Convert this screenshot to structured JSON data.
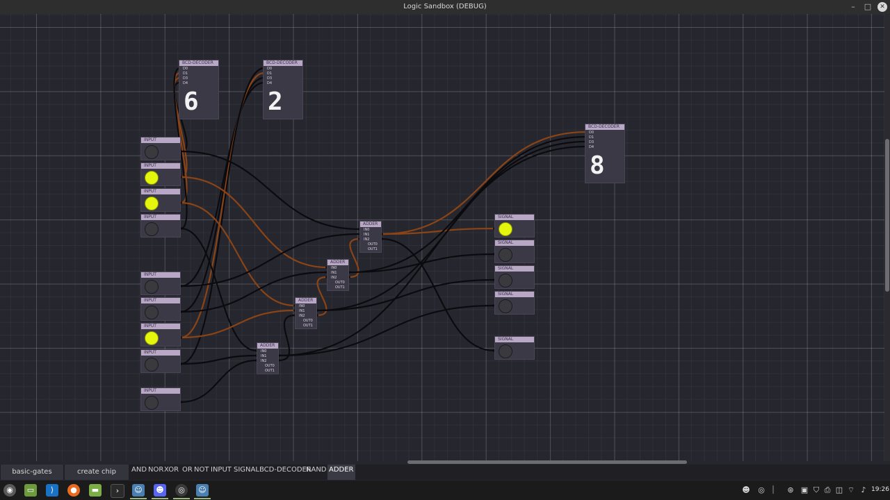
{
  "window": {
    "title": "Logic Sandbox (DEBUG)"
  },
  "colors": {
    "wire_off": "#0b0b0f",
    "wire_on": "#8a4416",
    "led_on": "#e4f50e"
  },
  "inputs": [
    {
      "id": "in1",
      "label": "INPUT",
      "on": false
    },
    {
      "id": "in2",
      "label": "INPUT",
      "on": true
    },
    {
      "id": "in3",
      "label": "INPUT",
      "on": true
    },
    {
      "id": "in4",
      "label": "INPUT",
      "on": false
    },
    {
      "id": "in5",
      "label": "INPUT",
      "on": false
    },
    {
      "id": "in6",
      "label": "INPUT",
      "on": false
    },
    {
      "id": "in7",
      "label": "INPUT",
      "on": true
    },
    {
      "id": "in8",
      "label": "INPUT",
      "on": false
    },
    {
      "id": "in9",
      "label": "INPUT",
      "on": false
    }
  ],
  "signals": [
    {
      "id": "s1",
      "label": "SIGNAL",
      "on": true
    },
    {
      "id": "s2",
      "label": "SIGNAL",
      "on": false
    },
    {
      "id": "s3",
      "label": "SIGNAL",
      "on": false
    },
    {
      "id": "s4",
      "label": "SIGNAL",
      "on": false
    },
    {
      "id": "s5",
      "label": "SIGNAL",
      "on": false
    }
  ],
  "adders": [
    {
      "id": "a1",
      "label": "ADDER",
      "ports": [
        "IN0",
        "IN1",
        "IN2"
      ],
      "outs": [
        "OUT0",
        "OUT1"
      ]
    },
    {
      "id": "a2",
      "label": "ADDER",
      "ports": [
        "IN0",
        "IN1",
        "IN2"
      ],
      "outs": [
        "OUT0",
        "OUT1"
      ]
    },
    {
      "id": "a3",
      "label": "ADDER",
      "ports": [
        "IN0",
        "IN1",
        "IN2"
      ],
      "outs": [
        "OUT0",
        "OUT1"
      ]
    },
    {
      "id": "a4",
      "label": "ADDER",
      "ports": [
        "IN0",
        "IN1",
        "IN2"
      ],
      "outs": [
        "OUT0",
        "OUT1"
      ]
    }
  ],
  "decoders": [
    {
      "id": "d1",
      "label": "BCD-DECODER",
      "ports": [
        "D0",
        "D1",
        "D3",
        "D4"
      ],
      "digit": "6"
    },
    {
      "id": "d2",
      "label": "BCD-DECODER",
      "ports": [
        "D0",
        "D1",
        "D3",
        "D4"
      ],
      "digit": "2"
    },
    {
      "id": "d3",
      "label": "BCD-DECODER",
      "ports": [
        "D0",
        "D1",
        "D3",
        "D4"
      ],
      "digit": "8"
    }
  ],
  "tabs": [
    "basic-gates",
    "create chip"
  ],
  "palette": [
    "AND",
    "NOR",
    "XOR",
    "OR",
    "NOT",
    "INPUT",
    "SIGNAL",
    "BCD-DECODER",
    "NAND",
    "ADDER"
  ],
  "palette_active": "ADDER",
  "taskbar": {
    "apps": [
      "menu-icon",
      "files-icon",
      "vscode-icon",
      "firefox-icon",
      "folder-icon",
      "terminal-icon",
      "godot-icon",
      "discord-icon",
      "github-icon",
      "godot-running-icon"
    ],
    "tray": [
      "discord-tray-icon",
      "github-tray-icon",
      "steam-tray-icon",
      "clipboard-tray-icon",
      "shield-tray-icon",
      "printer-tray-icon",
      "updates-tray-icon",
      "wifi-icon",
      "volume-icon"
    ],
    "clock": "19:26"
  }
}
